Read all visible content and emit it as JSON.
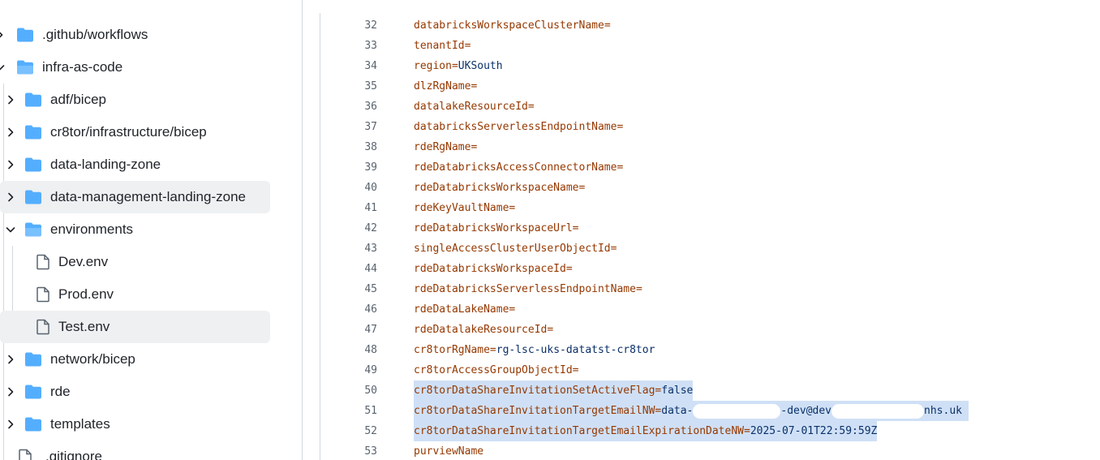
{
  "tree": [
    {
      "label": ".github/workflows",
      "type": "folder",
      "expanded": false
    },
    {
      "label": "infra-as-code",
      "type": "folder-open",
      "expanded": true
    },
    {
      "label": "adf/bicep",
      "type": "folder",
      "expanded": false
    },
    {
      "label": "cr8tor/infrastructure/bicep",
      "type": "folder",
      "expanded": false
    },
    {
      "label": "data-landing-zone",
      "type": "folder",
      "expanded": false
    },
    {
      "label": "data-management-landing-zone",
      "type": "folder",
      "expanded": false
    },
    {
      "label": "environments",
      "type": "folder-open",
      "expanded": true
    },
    {
      "label": "Dev.env",
      "type": "file"
    },
    {
      "label": "Prod.env",
      "type": "file"
    },
    {
      "label": "Test.env",
      "type": "file",
      "selected": true
    },
    {
      "label": "network/bicep",
      "type": "folder",
      "expanded": false
    },
    {
      "label": "rde",
      "type": "folder",
      "expanded": false
    },
    {
      "label": "templates",
      "type": "folder",
      "expanded": false
    },
    {
      "label": ".gitignore",
      "type": "file"
    }
  ],
  "code_lines": [
    {
      "n": "32",
      "key": "databricksWorkspaceClusterName",
      "eq": "="
    },
    {
      "n": "33",
      "key": "tenantId",
      "eq": "="
    },
    {
      "n": "34",
      "key": "region",
      "eq": "=",
      "value": "UKSouth"
    },
    {
      "n": "35",
      "key": "dlzRgName",
      "eq": "="
    },
    {
      "n": "36",
      "key": "datalakeResourceId",
      "eq": "="
    },
    {
      "n": "37",
      "key": "databricksServerlessEndpointName",
      "eq": "="
    },
    {
      "n": "38",
      "key": "rdeRgName",
      "eq": "="
    },
    {
      "n": "39",
      "key": "rdeDatabricksAccessConnectorName",
      "eq": "="
    },
    {
      "n": "40",
      "key": "rdeDatabricksWorkspaceName",
      "eq": "="
    },
    {
      "n": "41",
      "key": "rdeKeyVaultName",
      "eq": "="
    },
    {
      "n": "42",
      "key": "rdeDatabricksWorkspaceUrl",
      "eq": "="
    },
    {
      "n": "43",
      "key": "singleAccessClusterUserObjectId",
      "eq": "="
    },
    {
      "n": "44",
      "key": "rdeDatabricksWorkspaceId",
      "eq": "="
    },
    {
      "n": "45",
      "key": "rdeDatabricksServerlessEndpointName",
      "eq": "="
    },
    {
      "n": "46",
      "key": "rdeDataLakeName",
      "eq": "="
    },
    {
      "n": "47",
      "key": "rdeDatalakeResourceId",
      "eq": "="
    },
    {
      "n": "48",
      "key": "cr8torRgName",
      "eq": "=",
      "value": "rg-lsc-uks-datatst-cr8tor"
    },
    {
      "n": "49",
      "key": "cr8torAccessGroupObjectId",
      "eq": "="
    },
    {
      "n": "50",
      "key": "cr8torDataShareInvitationSetActiveFlag",
      "eq": "=",
      "value": "false",
      "selected": true
    },
    {
      "n": "51",
      "key": "cr8torDataShareInvitationTargetEmailNW",
      "eq": "=",
      "value_parts": [
        "data-",
        "-dev@dev",
        "nhs.uk"
      ],
      "selected": true
    },
    {
      "n": "52",
      "key": "cr8torDataShareInvitationTargetEmailExpirationDateNW",
      "eq": "=",
      "value": "2025-07-01T22:59:59Z",
      "selected": true
    },
    {
      "n": "53",
      "key": "purviewName",
      "eq": ""
    }
  ],
  "colors": {
    "folder": "#54aeff",
    "selection": "#cfe0f6",
    "key": "#953800",
    "value": "#0a3069"
  }
}
